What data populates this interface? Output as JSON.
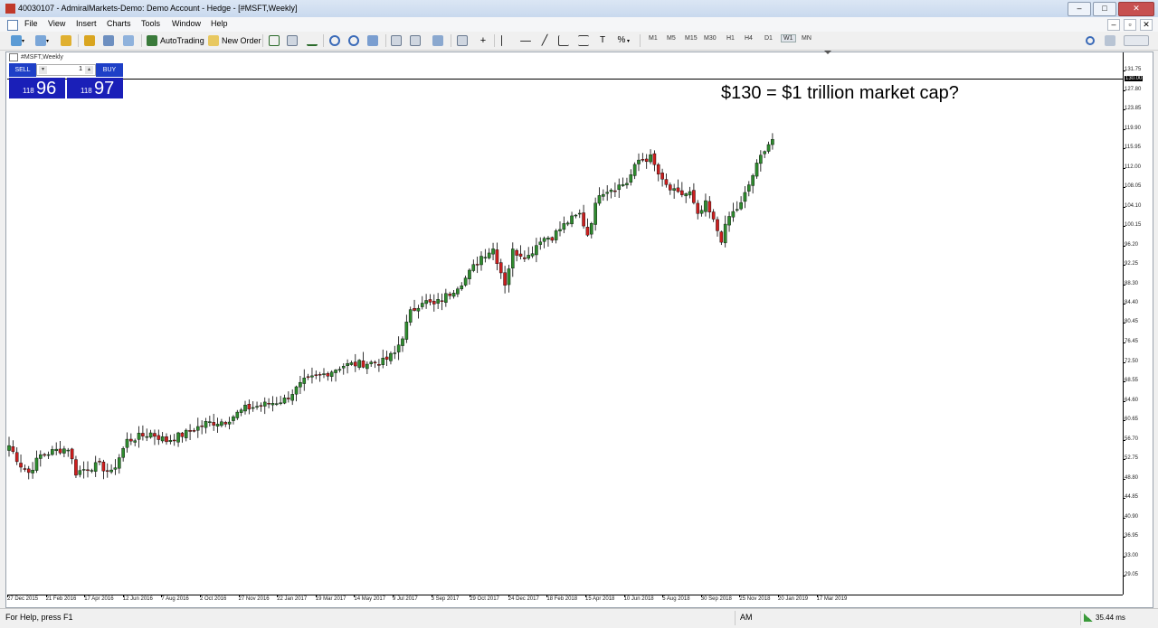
{
  "window": {
    "title": "40030107 - AdmiralMarkets-Demo: Demo Account - Hedge - [#MSFT,Weekly]",
    "min_btn": "‒",
    "max_btn": "□",
    "close_btn": "✕"
  },
  "menu": [
    "File",
    "View",
    "Insert",
    "Charts",
    "Tools",
    "Window",
    "Help"
  ],
  "mdi_controls": [
    "‒",
    "▫",
    "✕"
  ],
  "toolbar": {
    "autotrading_label": "AutoTrading",
    "new_order_label": "New Order",
    "timeframes": [
      "M1",
      "M5",
      "M15",
      "M30",
      "H1",
      "H4",
      "D1",
      "W1",
      "MN"
    ],
    "active_timeframe": "W1"
  },
  "chart": {
    "tab_label": "#MSFT,Weekly",
    "annotation": "$130 = $1 trillion market cap?",
    "hline_label": "130.00"
  },
  "one_click": {
    "sell_label": "SELL",
    "buy_label": "BUY",
    "lot": "1",
    "sell_small": "118",
    "sell_big": "96",
    "buy_small": "118",
    "buy_big": "97"
  },
  "chart_data": {
    "type": "candlestick",
    "symbol": "#MSFT",
    "timeframe": "Weekly",
    "ylim": [
      26.0,
      134.0
    ],
    "yticks": [
      "131.75",
      "127.80",
      "123.85",
      "119.90",
      "115.95",
      "112.00",
      "108.05",
      "104.10",
      "100.15",
      "96.20",
      "92.25",
      "88.30",
      "84.40",
      "80.45",
      "76.45",
      "72.50",
      "68.55",
      "64.60",
      "60.65",
      "56.70",
      "52.75",
      "48.80",
      "44.85",
      "40.90",
      "36.95",
      "33.00",
      "29.05"
    ],
    "xlabels": [
      "27 Dec 2015",
      "21 Feb 2016",
      "17 Apr 2016",
      "12 Jun 2016",
      "7 Aug 2016",
      "2 Oct 2016",
      "27 Nov 2016",
      "22 Jan 2017",
      "19 Mar 2017",
      "14 May 2017",
      "9 Jul 2017",
      "3 Sep 2017",
      "29 Oct 2017",
      "24 Dec 2017",
      "18 Feb 2018",
      "15 Apr 2018",
      "10 Jun 2018",
      "5 Aug 2018",
      "30 Sep 2018",
      "25 Nov 2018",
      "20 Jan 2019",
      "17 Mar 2019"
    ],
    "hline": 130.0,
    "colors": {
      "up": "#2e8b2e",
      "down": "#cc1f1f",
      "wick": "#000000"
    },
    "anchors": [
      [
        0,
        55.5
      ],
      [
        3,
        51.5
      ],
      [
        5,
        50
      ],
      [
        8,
        53.5
      ],
      [
        12,
        54.5
      ],
      [
        15,
        55
      ],
      [
        17,
        50
      ],
      [
        20,
        51
      ],
      [
        23,
        51.5
      ],
      [
        26,
        49.8
      ],
      [
        30,
        56.5
      ],
      [
        36,
        58
      ],
      [
        40,
        56.5
      ],
      [
        45,
        58
      ],
      [
        50,
        60
      ],
      [
        55,
        60.5
      ],
      [
        60,
        63
      ],
      [
        65,
        63.8
      ],
      [
        70,
        64.8
      ],
      [
        75,
        68.5
      ],
      [
        80,
        70
      ],
      [
        85,
        71.8
      ],
      [
        90,
        72.2
      ],
      [
        95,
        72.5
      ],
      [
        98,
        74.2
      ],
      [
        100,
        77.8
      ],
      [
        102,
        82.5
      ],
      [
        105,
        85
      ],
      [
        108,
        84
      ],
      [
        112,
        86.5
      ],
      [
        116,
        89.5
      ],
      [
        120,
        94
      ],
      [
        123,
        95.5
      ],
      [
        126,
        88.5
      ],
      [
        128,
        95
      ],
      [
        132,
        94
      ],
      [
        135,
        97.5
      ],
      [
        138,
        98
      ],
      [
        142,
        101
      ],
      [
        145,
        102.5
      ],
      [
        147,
        98.5
      ],
      [
        150,
        107
      ],
      [
        154,
        108
      ],
      [
        157,
        109
      ],
      [
        160,
        113.5
      ],
      [
        163,
        114
      ],
      [
        166,
        109
      ],
      [
        168,
        107.5
      ],
      [
        170,
        106.5
      ],
      [
        173,
        106.8
      ],
      [
        175,
        102
      ],
      [
        177,
        104.5
      ],
      [
        179,
        101
      ],
      [
        181,
        97.5
      ],
      [
        183,
        102
      ],
      [
        186,
        104.5
      ],
      [
        189,
        110.5
      ],
      [
        192,
        116
      ],
      [
        194,
        117.8
      ]
    ]
  }
}
